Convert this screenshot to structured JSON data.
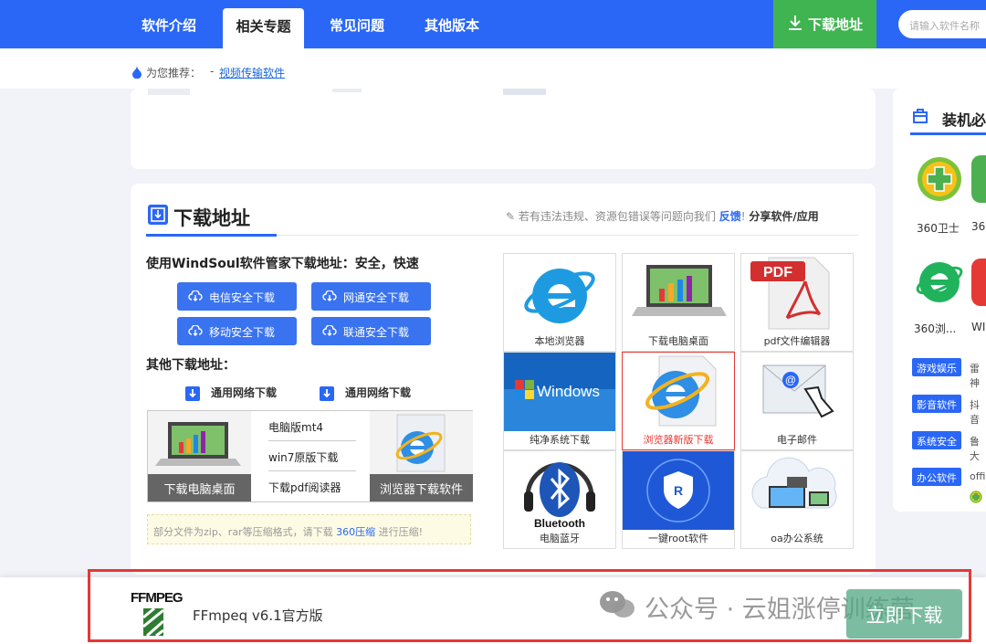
{
  "nav": {
    "tabs": [
      "软件介绍",
      "相关专题",
      "常见问题",
      "其他版本"
    ],
    "active_tab": "相关专题",
    "download_label": "下载地址",
    "search_placeholder": "请输入软件名称"
  },
  "recommend": {
    "label": "为您推荐：",
    "sep": "-",
    "link": "视频传输软件"
  },
  "download_section": {
    "title": "下载地址",
    "notice_prefix": "若有违法违规、资源包错误等问题向我们",
    "notice_feedback": "反馈",
    "notice_bang": "!",
    "notice_share": "分享软件/应用",
    "windsoul_heading": "使用WindSoul软件管家下载地址：安全，快速",
    "buttons": [
      "电信安全下载",
      "网通安全下载",
      "移动安全下载",
      "联通安全下载"
    ],
    "other_heading": "其他下载地址：",
    "general_links": [
      "通用网络下载",
      "通用网络下载"
    ],
    "box": {
      "left_caption": "下载电脑桌面",
      "links": [
        "电脑版mt4",
        "win7原版下载",
        "下载pdf阅读器"
      ],
      "right_caption": "浏览器下载软件"
    },
    "tip": {
      "prefix": "部分文件为zip、rar等压缩格式，请下载",
      "link": "360压缩",
      "suffix": "进行压缩!"
    }
  },
  "grid": [
    {
      "caption": "本地浏览器",
      "icon": "ie-icon"
    },
    {
      "caption": "下载电脑桌面",
      "icon": "laptop-icon"
    },
    {
      "caption": "pdf文件编辑器",
      "icon": "pdf-icon"
    },
    {
      "caption": "纯净系统下载",
      "icon": "windows-icon"
    },
    {
      "caption": "浏览器新版下载",
      "icon": "ie-doc-icon",
      "selected": true
    },
    {
      "caption": "电子邮件",
      "icon": "email-icon"
    },
    {
      "caption": "电脑蓝牙",
      "icon": "bluetooth-icon"
    },
    {
      "caption": "一键root软件",
      "icon": "root-icon"
    },
    {
      "caption": "oa办公系统",
      "icon": "cloud-devices-icon"
    }
  ],
  "sidebar": {
    "title": "装机必",
    "apps": [
      {
        "label": "360卫士"
      },
      {
        "label": "36"
      },
      {
        "label": "360浏..."
      },
      {
        "label": "WI"
      }
    ],
    "categories": [
      {
        "label": "游戏娱乐",
        "text": "雷神"
      },
      {
        "label": "影音软件",
        "text": "抖音"
      },
      {
        "label": "系统安全",
        "text": "鲁大"
      },
      {
        "label": "办公软件",
        "text": "offi"
      }
    ]
  },
  "bottom_bar": {
    "logo_text": "FFMPEG",
    "app_name": "FFmpeq v6.1官方版",
    "watermark": "公众号 · 云姐涨停训练营",
    "download_now": "立即下载"
  },
  "colors": {
    "primary": "#2a67f7",
    "green": "#3fb450",
    "highlight": "#e53935"
  }
}
